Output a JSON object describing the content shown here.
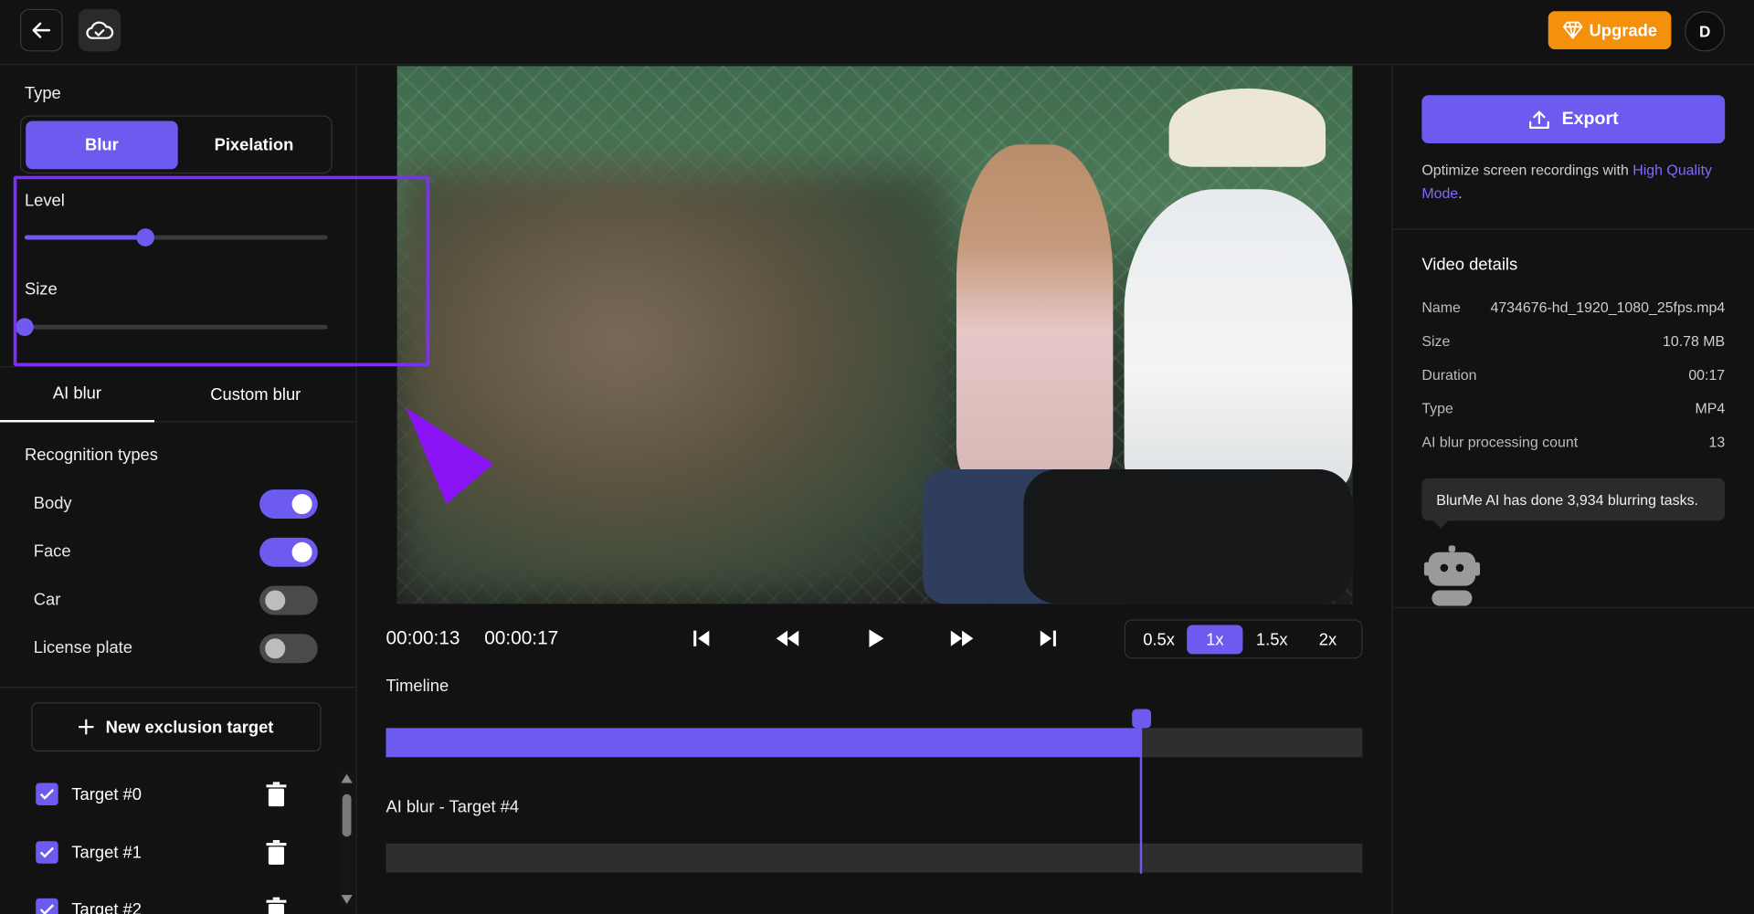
{
  "topbar": {
    "back_icon": "arrow-left-icon",
    "cloud_icon": "cloud-check-icon",
    "upgrade_label": "Upgrade",
    "upgrade_icon": "diamond-icon",
    "avatar_initial": "D"
  },
  "left_panel": {
    "type_label": "Type",
    "type_options": [
      "Blur",
      "Pixelation"
    ],
    "type_selected": "Blur",
    "level_label": "Level",
    "level_value": 0.4,
    "size_label": "Size",
    "size_value": 0.0,
    "tabs": [
      "AI blur",
      "Custom blur"
    ],
    "active_tab": "AI blur",
    "recognition_title": "Recognition types",
    "recognition_types": [
      {
        "label": "Body",
        "enabled": true
      },
      {
        "label": "Face",
        "enabled": true
      },
      {
        "label": "Car",
        "enabled": false
      },
      {
        "label": "License plate",
        "enabled": false
      }
    ],
    "new_exclusion_label": "New exclusion target",
    "targets": [
      {
        "label": "Target #0",
        "checked": true
      },
      {
        "label": "Target #1",
        "checked": true
      },
      {
        "label": "Target #2",
        "checked": true
      }
    ]
  },
  "player": {
    "current_time": "00:00:13",
    "total_time": "00:00:17",
    "controls": [
      "skip-back-icon",
      "rewind-icon",
      "play-icon",
      "fast-forward-icon",
      "skip-forward-icon"
    ],
    "speeds": [
      "0.5x",
      "1x",
      "1.5x",
      "2x"
    ],
    "active_speed": "1x",
    "timeline_label": "Timeline",
    "progress": 0.773,
    "track_label": "AI blur - Target #4"
  },
  "right_panel": {
    "export_label": "Export",
    "export_icon": "upload-icon",
    "optimize_text": "Optimize screen recordings with",
    "optimize_link": "High Quality Mode",
    "optimize_suffix": ".",
    "details_title": "Video details",
    "details": [
      {
        "key": "Name",
        "value": "4734676-hd_1920_1080_25fps.mp4"
      },
      {
        "key": "Size",
        "value": "10.78 MB"
      },
      {
        "key": "Duration",
        "value": "00:17"
      },
      {
        "key": "Type",
        "value": "MP4"
      },
      {
        "key": "AI blur processing count",
        "value": "13"
      }
    ],
    "tooltip_text": "BlurMe AI has done 3,934 blurring tasks.",
    "robot_icon": "robot-icon"
  },
  "colors": {
    "accent": "#6d5bf0",
    "upgrade": "#f5900b",
    "background": "#121212",
    "highlight": "#7b2ff7"
  }
}
